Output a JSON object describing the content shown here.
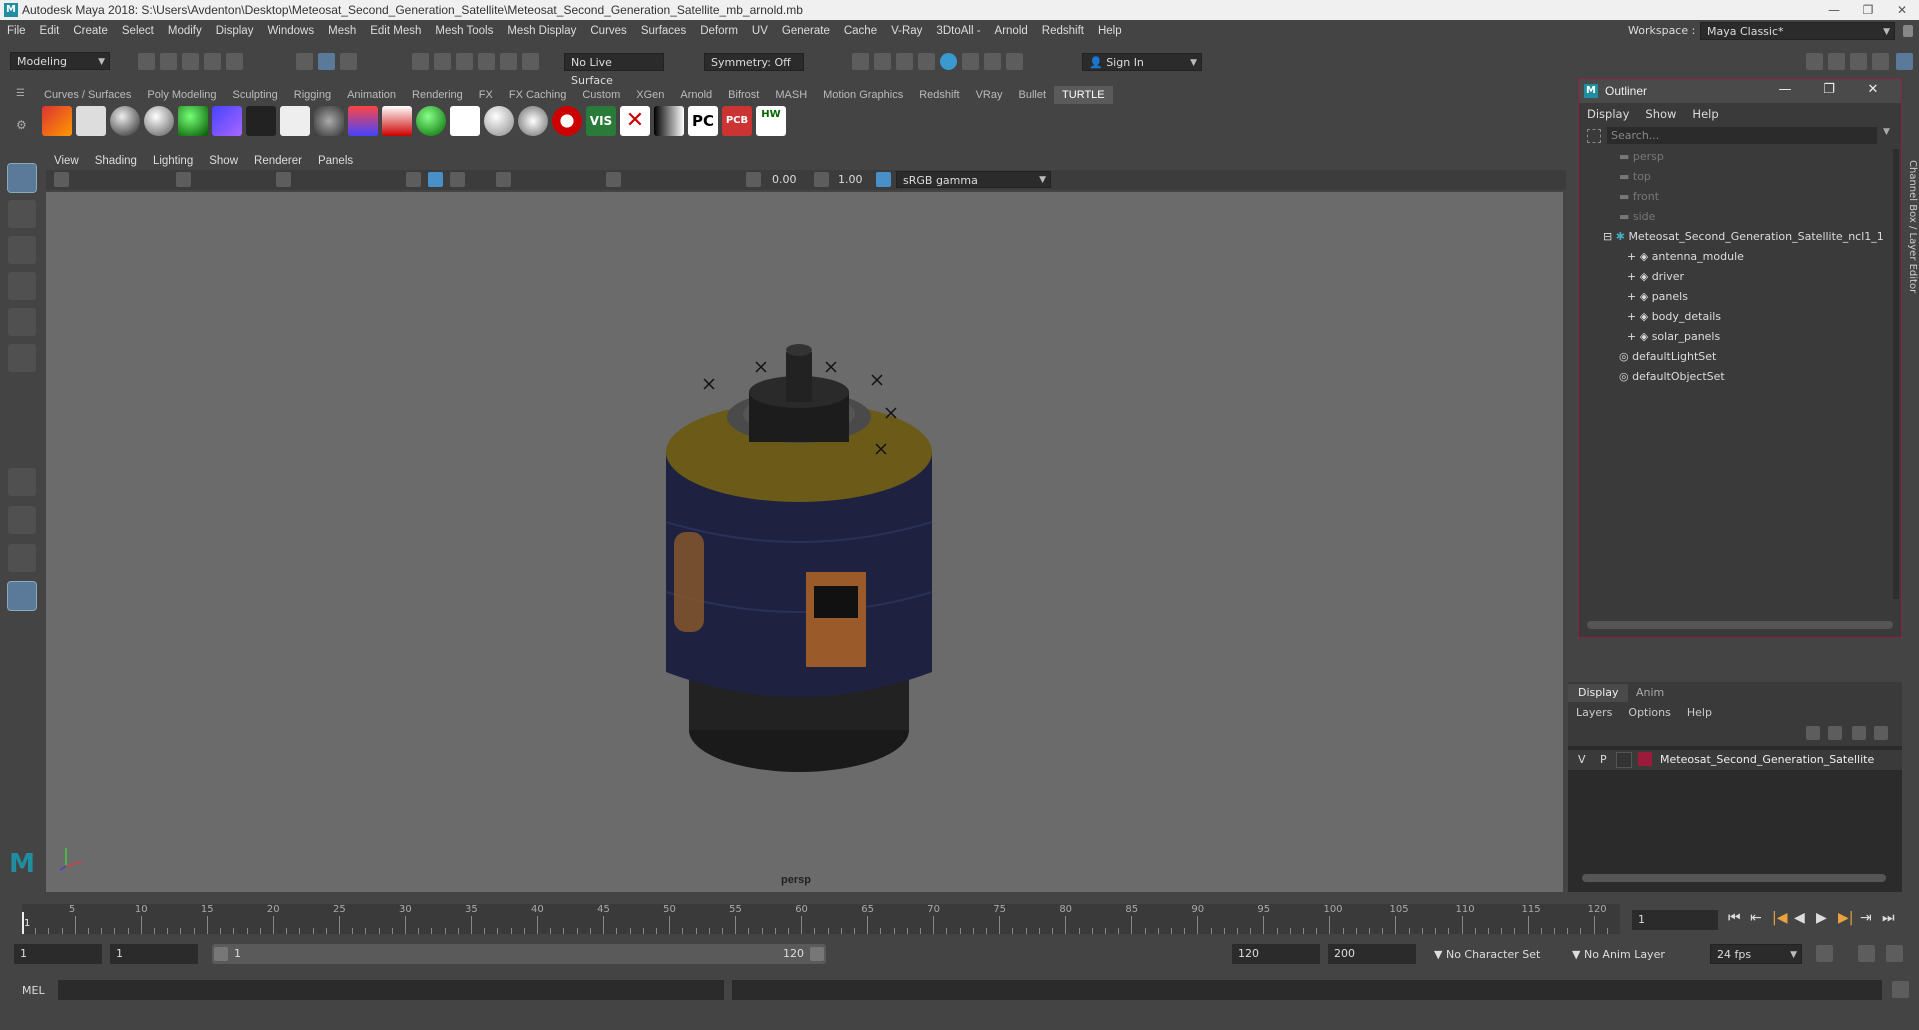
{
  "window": {
    "title": "Autodesk Maya 2018: S:\\Users\\Avdenton\\Desktop\\Meteosat_Second_Generation_Satellite\\Meteosat_Second_Generation_Satellite_mb_arnold.mb",
    "logo": "M",
    "controls": [
      "—",
      "❐",
      "✕"
    ]
  },
  "menubar": [
    "File",
    "Edit",
    "Create",
    "Select",
    "Modify",
    "Display",
    "Windows",
    "Mesh",
    "Edit Mesh",
    "Mesh Tools",
    "Mesh Display",
    "Curves",
    "Surfaces",
    "Deform",
    "UV",
    "Generate",
    "Cache",
    "V-Ray",
    "3DtoAll -",
    "Arnold",
    "Redshift",
    "Help"
  ],
  "workspace": {
    "label": "Workspace :",
    "value": "Maya Classic*"
  },
  "toolbar": {
    "mode": "Modeling",
    "live_surface": "No Live Surface",
    "symmetry": "Symmetry: Off",
    "sign_in": "Sign In"
  },
  "shelf_tabs": [
    "Curves / Surfaces",
    "Poly Modeling",
    "Sculpting",
    "Rigging",
    "Animation",
    "Rendering",
    "FX",
    "FX Caching",
    "Custom",
    "XGen",
    "Arnold",
    "Bifrost",
    "MASH",
    "Motion Graphics",
    "Redshift",
    "VRay",
    "Bullet",
    "TURTLE"
  ],
  "shelf_active": "TURTLE",
  "shelf_icon_labels": {
    "vis": "VIS",
    "pc": "PC",
    "pcb": "PCB",
    "hw": "HW"
  },
  "viewport": {
    "menu": [
      "View",
      "Shading",
      "Lighting",
      "Show",
      "Renderer",
      "Panels"
    ],
    "exposure": "0.00",
    "gamma": "1.00",
    "color_space": "sRGB gamma",
    "camera_label": "persp"
  },
  "outliner": {
    "title": "Outliner",
    "menu": [
      "Display",
      "Show",
      "Help"
    ],
    "search_placeholder": "Search...",
    "cameras": [
      "persp",
      "top",
      "front",
      "side"
    ],
    "group": "Meteosat_Second_Generation_Satellite_ncl1_1",
    "children": [
      "antenna_module",
      "driver",
      "panels",
      "body_details",
      "solar_panels"
    ],
    "sets": [
      "defaultLightSet",
      "defaultObjectSet"
    ]
  },
  "side_tab": "Channel Box / Layer Editor",
  "layer_editor": {
    "tabs": [
      "Display",
      "Anim"
    ],
    "menu": [
      "Layers",
      "Options",
      "Help"
    ],
    "layer": {
      "v": "V",
      "p": "P",
      "name": "Meteosat_Second_Generation_Satellite",
      "color": "#9b1b3a"
    }
  },
  "timeline": {
    "ticks": [
      5,
      10,
      15,
      20,
      25,
      30,
      35,
      40,
      45,
      50,
      55,
      60,
      65,
      70,
      75,
      80,
      85,
      90,
      95,
      100,
      105,
      110,
      115,
      120
    ],
    "start_tick": "1",
    "current_frame": "1"
  },
  "range": {
    "start": "1",
    "playback_start": "1",
    "slider_start": "1",
    "slider_end": "120",
    "playback_end": "120",
    "end": "200",
    "character_set": "No Character Set",
    "anim_layer": "No Anim Layer",
    "fps": "24 fps"
  },
  "command_line": {
    "lang": "MEL"
  },
  "colors": {
    "accent": "#1f8ea0",
    "outliner_border": "#8a2146",
    "layer_color": "#9b1b3a"
  }
}
